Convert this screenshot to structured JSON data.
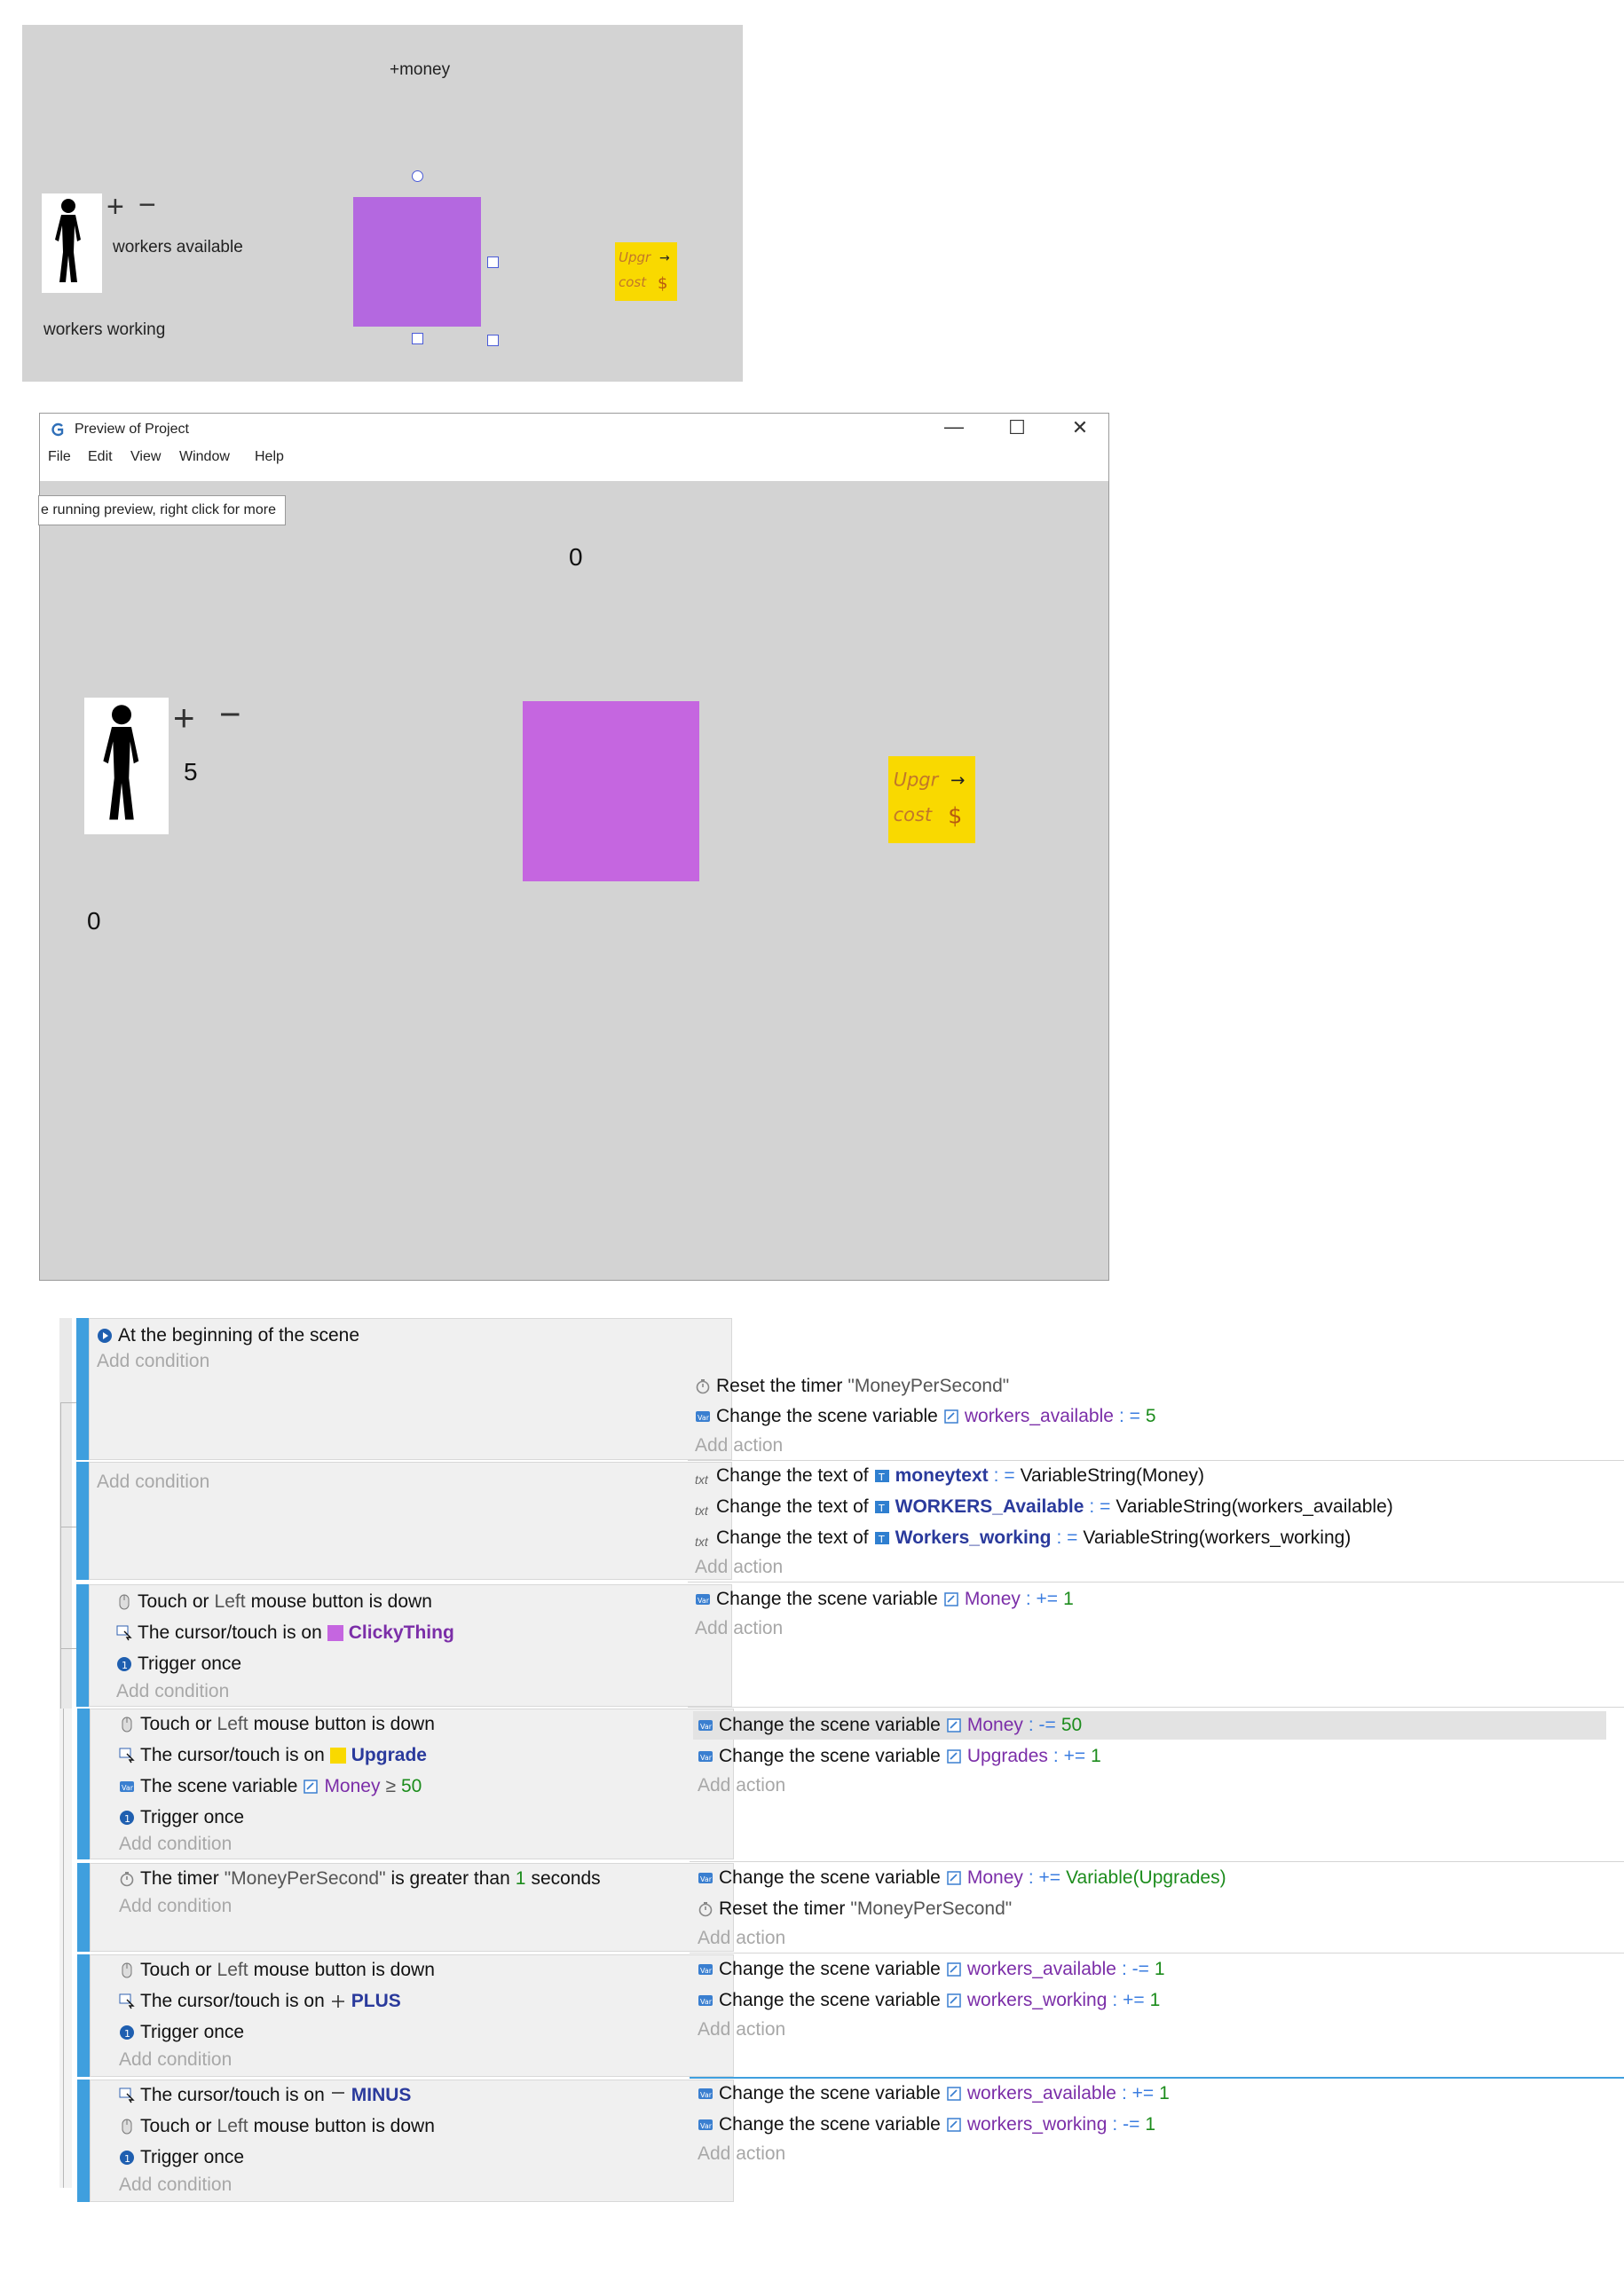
{
  "editor": {
    "money_label": "+money",
    "plus": "+",
    "minus": "−",
    "workers_available_label": "workers available",
    "workers_working_label": "workers working",
    "upgrade_text": "Upgr→ cost $"
  },
  "preview": {
    "window_title": "Preview of Project",
    "menu": [
      "File",
      "Edit",
      "View",
      "Window",
      "Help"
    ],
    "tooltip": "e running preview, right click for more",
    "money_value": "0",
    "workers_available_value": "5",
    "workers_working_value": "0",
    "plus": "+",
    "minus": "−",
    "minimize": "—",
    "maximize": "☐",
    "close": "✕"
  },
  "events": {
    "add_condition": "Add condition",
    "add_action": "Add action",
    "e1": {
      "cond1": "At the beginning of the scene",
      "act1_a": "Reset the timer",
      "act1_b": "\"MoneyPerSecond\"",
      "act2_a": "Change the scene variable",
      "act2_var": "workers_available",
      "act2_op": ": =",
      "act2_val": "5"
    },
    "e2": {
      "act1_a": "Change the text of",
      "act1_obj": "moneytext",
      "act1_op": ": =",
      "act1_val": "VariableString(Money)",
      "act2_a": "Change the text of",
      "act2_obj": "WORKERS_Available",
      "act2_op": ": =",
      "act2_val": "VariableString(workers_available)",
      "act3_a": "Change the text of",
      "act3_obj": "Workers_working",
      "act3_op": ": =",
      "act3_val": "VariableString(workers_working)"
    },
    "e3": {
      "cond1_a": "Touch or",
      "cond1_b": "Left",
      "cond1_c": "mouse button is down",
      "cond2_a": "The cursor/touch is on",
      "cond2_obj": "ClickyThing",
      "cond3": "Trigger once",
      "act1_a": "Change the scene variable",
      "act1_var": "Money",
      "act1_op": ": +=",
      "act1_val": "1"
    },
    "e4": {
      "cond1_a": "Touch or",
      "cond1_b": "Left",
      "cond1_c": "mouse button is down",
      "cond2_a": "The cursor/touch is on",
      "cond2_obj": "Upgrade",
      "cond3_a": "The scene variable",
      "cond3_var": "Money",
      "cond3_op": "≥",
      "cond3_val": "50",
      "cond4": "Trigger once",
      "act1_a": "Change the scene variable",
      "act1_var": "Money",
      "act1_op": ": -=",
      "act1_val": "50",
      "act2_a": "Change the scene variable",
      "act2_var": "Upgrades",
      "act2_op": ": +=",
      "act2_val": "1"
    },
    "e5": {
      "cond1_a": "The timer",
      "cond1_b": "\"MoneyPerSecond\"",
      "cond1_c": "is greater than",
      "cond1_d": "1",
      "cond1_e": "seconds",
      "act1_a": "Change the scene variable",
      "act1_var": "Money",
      "act1_op": ": +=",
      "act1_val": "Variable(Upgrades)",
      "act2_a": "Reset the timer",
      "act2_b": "\"MoneyPerSecond\""
    },
    "e6": {
      "cond1_a": "Touch or",
      "cond1_b": "Left",
      "cond1_c": "mouse button is down",
      "cond2_a": "The cursor/touch is on",
      "cond2_obj": "PLUS",
      "cond3": "Trigger once",
      "act1_a": "Change the scene variable",
      "act1_var": "workers_available",
      "act1_op": ": -=",
      "act1_val": "1",
      "act2_a": "Change the scene variable",
      "act2_var": "workers_working",
      "act2_op": ": +=",
      "act2_val": "1"
    },
    "e7": {
      "cond1_a": "The cursor/touch is on",
      "cond1_obj": "MINUS",
      "cond2_a": "Touch or",
      "cond2_b": "Left",
      "cond2_c": "mouse button is down",
      "cond3": "Trigger once",
      "act1_a": "Change the scene variable",
      "act1_var": "workers_available",
      "act1_op": ": +=",
      "act1_val": "1",
      "act2_a": "Change the scene variable",
      "act2_var": "workers_working",
      "act2_op": ": -=",
      "act2_val": "1"
    }
  },
  "colors": {
    "scene_bg": "#d3d3d3",
    "clicky_thing": "#b468e0",
    "upgrade_button": "#f9d900",
    "event_bar": "#3f9fde",
    "variable": "#7b2ea8",
    "number": "#1c8c1c"
  }
}
